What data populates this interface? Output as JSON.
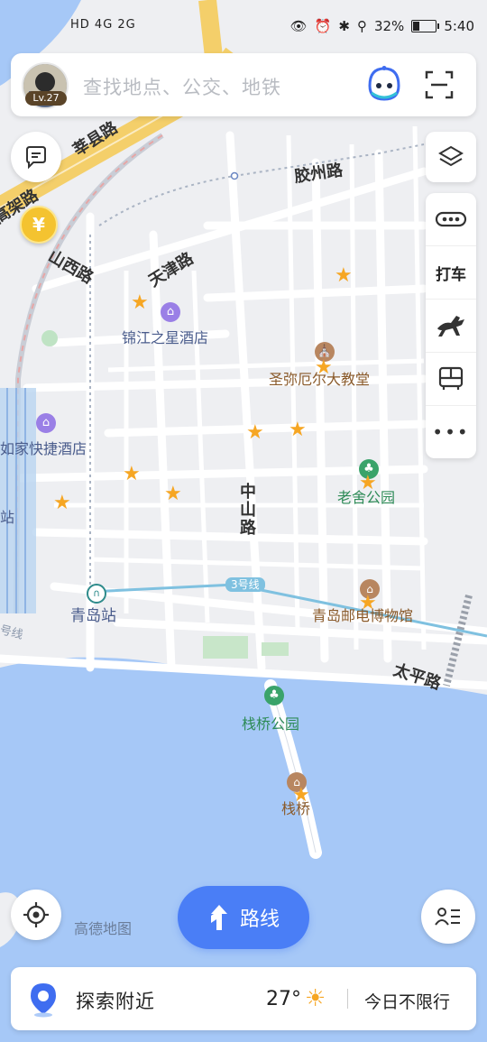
{
  "status_bar": {
    "network": "HD 4G 2G",
    "battery": "32%",
    "time": "5:40"
  },
  "search": {
    "placeholder": "查找地点、公交、地铁",
    "level_badge": "Lv.27"
  },
  "side_panel": {
    "taxi_label": "打车"
  },
  "map_labels": {
    "roads": {
      "xinxian": "莘县路",
      "gaojia": "高架路",
      "jiaozhou": "胶州路",
      "shanxi": "山西路",
      "tianjin": "天津路",
      "zhongshan": "中山路",
      "taiping": "太平路",
      "line3": "3号线",
      "line_partial": "号线"
    },
    "pois": {
      "jinjiang": "锦江之星酒店",
      "church": "圣弥厄尔大教堂",
      "rujia": "如家快捷酒店",
      "laoshe": "老舍公园",
      "qingdao_station": "青岛站",
      "station_partial": "站",
      "post_museum": "青岛邮电博物馆",
      "zhanqiao_park": "栈桥公园",
      "zhanqiao": "栈桥"
    }
  },
  "route_button": {
    "label": "路线"
  },
  "watermark": "高德地图",
  "bottom_bar": {
    "explore_label": "探索附近",
    "temperature": "27°",
    "restriction": "今日不限行"
  },
  "colors": {
    "accent": "#4a7ef6",
    "water": "#a6c8f7",
    "road_major": "#f4cf6a",
    "star": "#f6a623"
  }
}
